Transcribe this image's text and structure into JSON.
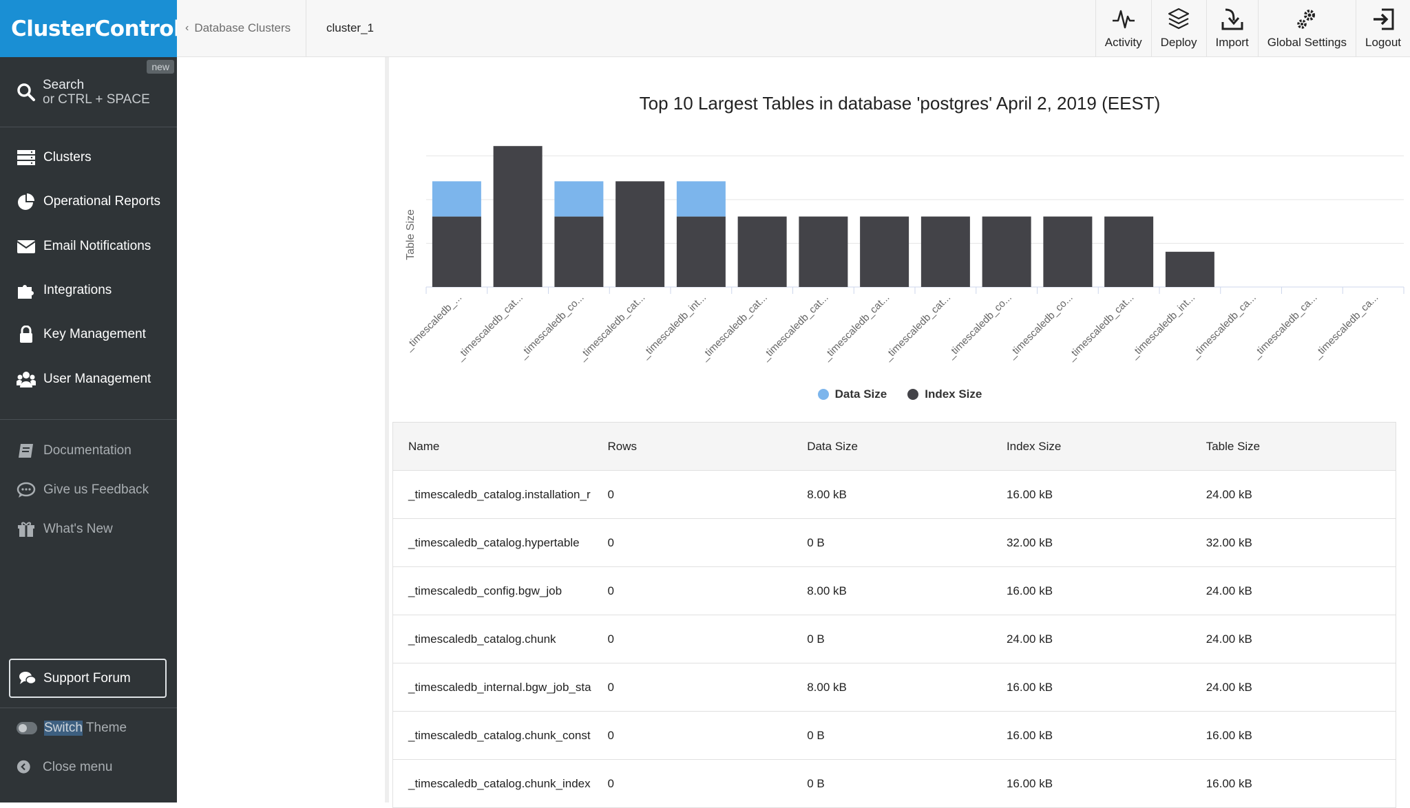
{
  "app": {
    "logo_text": "ClusterControl"
  },
  "sidebar": {
    "search": {
      "label": "Search",
      "hint": "or CTRL + SPACE",
      "badge": "new"
    },
    "items": [
      {
        "label": "Clusters",
        "icon": "server-stack-icon"
      },
      {
        "label": "Operational Reports",
        "icon": "pie-chart-icon"
      },
      {
        "label": "Email Notifications",
        "icon": "envelope-icon"
      },
      {
        "label": "Integrations",
        "icon": "puzzle-icon"
      },
      {
        "label": "Key Management",
        "icon": "lock-icon"
      },
      {
        "label": "User Management",
        "icon": "users-icon"
      }
    ],
    "secondary": [
      {
        "label": "Documentation",
        "icon": "book-icon"
      },
      {
        "label": "Give us Feedback",
        "icon": "chat-bubble-icon"
      },
      {
        "label": "What's New",
        "icon": "gift-icon"
      }
    ],
    "support_label": "Support Forum",
    "switch_theme": {
      "highlight": "Switch",
      "rest": " Theme"
    },
    "close_menu": "Close menu"
  },
  "topbar": {
    "breadcrumb_back": "Database Clusters",
    "breadcrumb_current": "cluster_1",
    "actions": [
      {
        "label": "Activity",
        "icon": "activity-icon"
      },
      {
        "label": "Deploy",
        "icon": "layers-icon"
      },
      {
        "label": "Import",
        "icon": "import-icon"
      },
      {
        "label": "Global Settings",
        "icon": "gears-icon"
      },
      {
        "label": "Logout",
        "icon": "logout-icon"
      }
    ]
  },
  "chart_data": {
    "type": "bar",
    "title": "Top 10 Largest Tables in database 'postgres' April 2, 2019 (EEST)",
    "ylabel": "Table Size",
    "xlabel": "",
    "stacked": true,
    "categories": [
      "_timescaledb_...",
      "_timescaledb_cat...",
      "_timescaledb_co...",
      "_timescaledb_cat...",
      "_timescaledb_int...",
      "_timescaledb_cat...",
      "_timescaledb_cat...",
      "_timescaledb_cat...",
      "_timescaledb_cat...",
      "_timescaledb_co...",
      "_timescaledb_co...",
      "_timescaledb_cat...",
      "_timescaledb_int...",
      "_timescaledb_ca...",
      "_timescaledb_ca...",
      "_timescaledb_ca..."
    ],
    "series": [
      {
        "name": "Index Size",
        "color": "#434348",
        "values": [
          16,
          32,
          16,
          24,
          16,
          16,
          16,
          16,
          16,
          16,
          16,
          16,
          8,
          0,
          0,
          0
        ]
      },
      {
        "name": "Data Size",
        "color": "#7cb5ec",
        "values": [
          8,
          0,
          8,
          0,
          8,
          0,
          0,
          0,
          0,
          0,
          0,
          0,
          0,
          0,
          0,
          0
        ]
      }
    ],
    "ylim": [
      0,
      30
    ],
    "grid": true,
    "legend_position": "bottom"
  },
  "table": {
    "columns": [
      "Name",
      "Rows",
      "Data Size",
      "Index Size",
      "Table Size"
    ],
    "rows": [
      [
        "_timescaledb_catalog.installation_r",
        "0",
        "8.00 kB",
        "16.00 kB",
        "24.00 kB"
      ],
      [
        "_timescaledb_catalog.hypertable",
        "0",
        "0 B",
        "32.00 kB",
        "32.00 kB"
      ],
      [
        "_timescaledb_config.bgw_job",
        "0",
        "8.00 kB",
        "16.00 kB",
        "24.00 kB"
      ],
      [
        "_timescaledb_catalog.chunk",
        "0",
        "0 B",
        "24.00 kB",
        "24.00 kB"
      ],
      [
        "_timescaledb_internal.bgw_job_sta",
        "0",
        "8.00 kB",
        "16.00 kB",
        "24.00 kB"
      ],
      [
        "_timescaledb_catalog.chunk_const",
        "0",
        "0 B",
        "16.00 kB",
        "16.00 kB"
      ],
      [
        "_timescaledb_catalog.chunk_index",
        "0",
        "0 B",
        "16.00 kB",
        "16.00 kB"
      ]
    ]
  }
}
